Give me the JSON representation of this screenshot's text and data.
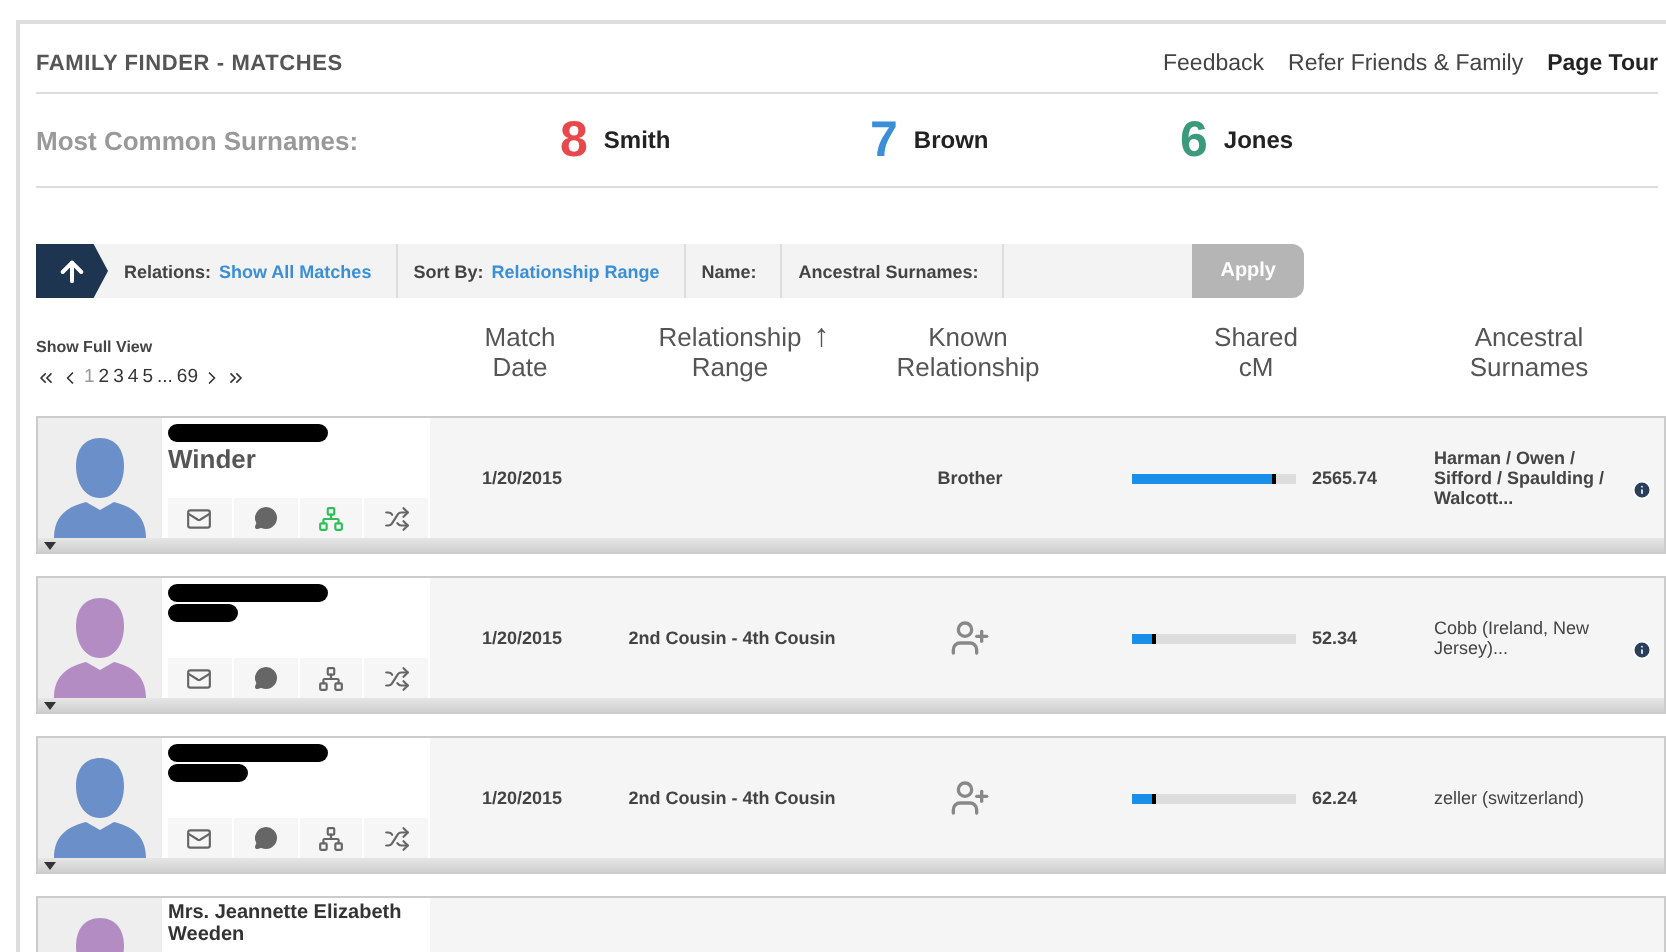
{
  "header": {
    "logo": "FAMILY FINDER - MATCHES",
    "links": [
      {
        "label": "Feedback",
        "kind": "link"
      },
      {
        "label": "Refer Friends & Family",
        "kind": "link"
      },
      {
        "label": "Page Tour",
        "kind": "strong"
      }
    ]
  },
  "surnames": {
    "label": "Most Common Surnames:",
    "items": [
      {
        "count": "8",
        "name": "Smith",
        "color": "#e8474c"
      },
      {
        "count": "7",
        "name": "Brown",
        "color": "#3a8fd6"
      },
      {
        "count": "6",
        "name": "Jones",
        "color": "#3a9a7a"
      }
    ]
  },
  "filters": {
    "segments": [
      {
        "label": "Relations:",
        "value": "Show All Matches"
      },
      {
        "label": "Sort By:",
        "value": "Relationship Range"
      },
      {
        "label": "Name:"
      },
      {
        "label": "Ancestral Surnames:"
      }
    ],
    "apply": {
      "label": "Apply",
      "disabled": true
    }
  },
  "pager": {
    "toggle": "Show Full View",
    "pages": [
      {
        "label": "1",
        "selected": true
      },
      {
        "label": "2",
        "selected": false
      },
      {
        "label": "3",
        "selected": false
      },
      {
        "label": "4",
        "selected": false
      },
      {
        "label": "5",
        "selected": false
      }
    ],
    "ellipsis": "...",
    "last": "69"
  },
  "columns": [
    {
      "label": "Match Date"
    },
    {
      "label": "Relationship Range",
      "sort_indicator": "↑"
    },
    {
      "label": "Known Relationship"
    },
    {
      "label": "Shared cM"
    },
    {
      "label": "Ancestral Surnames"
    }
  ],
  "matches": [
    {
      "color": "#6b8fc9",
      "name_lines": [
        {
          "kind": "redacted"
        },
        {
          "kind": "surname",
          "text": "Winder"
        }
      ],
      "tree_linked": true,
      "date": "1/20/2015",
      "known": {
        "kind": "text",
        "text": "Brother"
      },
      "shared": {
        "level": 0.88,
        "reading": "2565.74"
      },
      "ancestral": {
        "text": "Harman / Owen / Sifford / Spaulding / Walcott...",
        "bold": true
      },
      "info": true
    },
    {
      "color": "#b48cc4",
      "name_lines": [
        {
          "kind": "redacted"
        },
        {
          "kind": "redacted"
        }
      ],
      "tree_linked": false,
      "date": "1/20/2015",
      "range": "2nd Cousin - 4th Cousin",
      "known": {
        "kind": "add"
      },
      "shared": {
        "level": 0.15,
        "reading": "52.34"
      },
      "ancestral": {
        "text": "Cobb (Ireland, New Jersey)...",
        "bold": false
      },
      "info": true
    },
    {
      "color": "#6b8fc9",
      "name_lines": [
        {
          "kind": "redacted"
        },
        {
          "kind": "redacted"
        }
      ],
      "tree_linked": false,
      "date": "1/20/2015",
      "range": "2nd Cousin - 4th Cousin",
      "known": {
        "kind": "add"
      },
      "shared": {
        "level": 0.15,
        "reading": "62.24"
      },
      "ancestral": {
        "text": "zeller (switzerland)",
        "bold": false
      }
    },
    {
      "color": "#b48cc4",
      "name_lines": [
        {
          "kind": "text",
          "text": "Mrs. Jeannette Elizabeth"
        },
        {
          "kind": "text",
          "text": "Weeden"
        }
      ]
    }
  ]
}
